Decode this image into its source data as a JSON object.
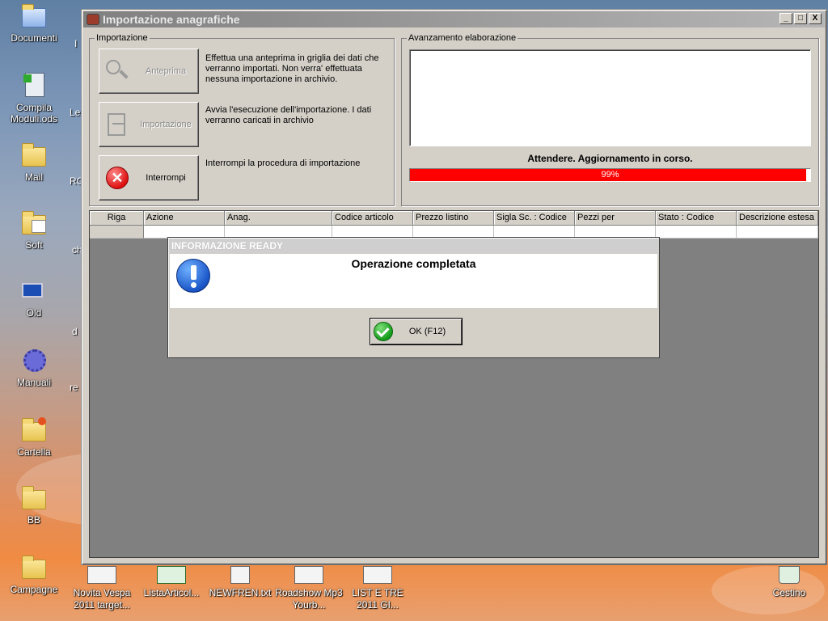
{
  "desktop": {
    "icons_left": [
      {
        "label": "Documenti"
      },
      {
        "label": "Compila Moduli.ods"
      },
      {
        "label": "Mail"
      },
      {
        "label": "Soft"
      },
      {
        "label": "Old"
      },
      {
        "label": "Manuali"
      },
      {
        "label": "Cartella"
      },
      {
        "label": "BB"
      },
      {
        "label": "Campagne"
      }
    ],
    "partial_labels": [
      "I",
      "Le",
      "RC",
      "ch",
      "d",
      "re"
    ],
    "icons_bottom": [
      {
        "label": "Novita Vespa 2011 target..."
      },
      {
        "label": "ListaArticol..."
      },
      {
        "label": "NEWFREN.txt"
      },
      {
        "label": "Roadshow Mp3 Yourb..."
      },
      {
        "label": "LIST E TRE 2011 GI..."
      },
      {
        "label": "Cestino"
      }
    ]
  },
  "window": {
    "title": "Importazione anagrafiche",
    "controls": {
      "minimize": "_",
      "maximize": "□",
      "close": "X"
    },
    "import_group": {
      "legend": "Importazione",
      "buttons": [
        {
          "label": "Anteprima",
          "desc": "Effettua una anteprima in griglia dei dati che verranno importati. Non verra' effettuata nessuna importazione in archivio.",
          "enabled": false
        },
        {
          "label": "Importazione",
          "desc": "Avvia l'esecuzione dell'importazione. I dati verranno caricati in archivio",
          "enabled": false
        },
        {
          "label": "Interrompi",
          "desc": "Interrompi la procedura di importazione",
          "enabled": true
        }
      ]
    },
    "progress_group": {
      "legend": "Avanzamento elaborazione",
      "status": "Attendere. Aggiornamento in corso.",
      "percent": 99,
      "percent_label": "99%",
      "bar_color": "#ff0000"
    },
    "grid": {
      "columns": [
        "Riga",
        "Azione",
        "Anag.",
        "Codice articolo",
        "Prezzo listino",
        "Sigla Sc. : Codice",
        "Pezzi per",
        "Stato : Codice",
        "Descrizione estesa"
      ]
    }
  },
  "dialog": {
    "title": "INFORMAZIONE READY",
    "message": "Operazione completata",
    "ok_label": "OK (F12)"
  }
}
